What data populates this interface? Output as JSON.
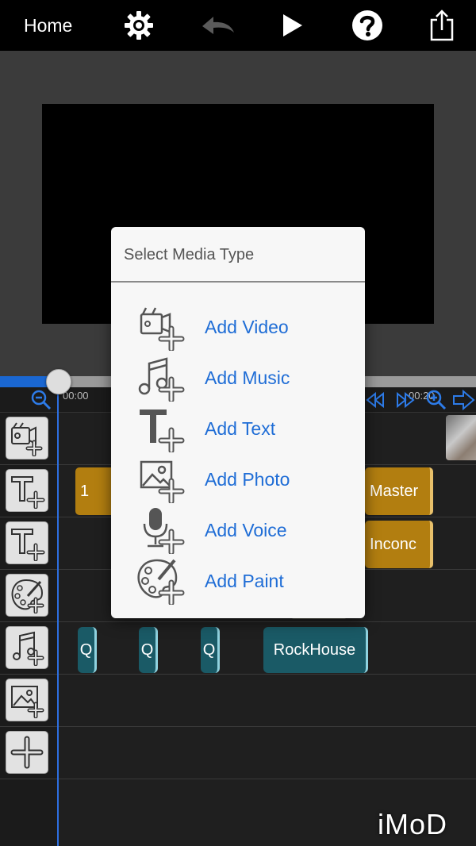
{
  "toolbar": {
    "home_label": "Home",
    "icons": [
      "gear-icon",
      "undo-icon",
      "play-icon",
      "help-icon",
      "share-icon"
    ]
  },
  "timeline": {
    "start_time": "00:00",
    "end_time": "00:20"
  },
  "tracks": {
    "text_clips_row1": [
      {
        "label": "1"
      },
      {
        "label": "Master"
      }
    ],
    "text_clips_row2": [
      {
        "label": "Inconc"
      }
    ],
    "music_clips": [
      {
        "label": "Q"
      },
      {
        "label": "Q"
      },
      {
        "label": "Q"
      },
      {
        "label": "RockHouse"
      }
    ]
  },
  "popup": {
    "title": "Select Media Type",
    "items": [
      {
        "label": "Add Video",
        "icon": "video-camera-add-icon"
      },
      {
        "label": "Add Music",
        "icon": "music-add-icon"
      },
      {
        "label": "Add Text",
        "icon": "text-add-icon"
      },
      {
        "label": "Add Photo",
        "icon": "photo-add-icon"
      },
      {
        "label": "Add Voice",
        "icon": "microphone-add-icon"
      },
      {
        "label": "Add Paint",
        "icon": "paint-palette-add-icon"
      }
    ]
  },
  "colors": {
    "accent_blue": "#1f6dd6",
    "clip_gold": "#b27e10",
    "clip_teal": "#1a5a66"
  },
  "watermark": "iMoD"
}
